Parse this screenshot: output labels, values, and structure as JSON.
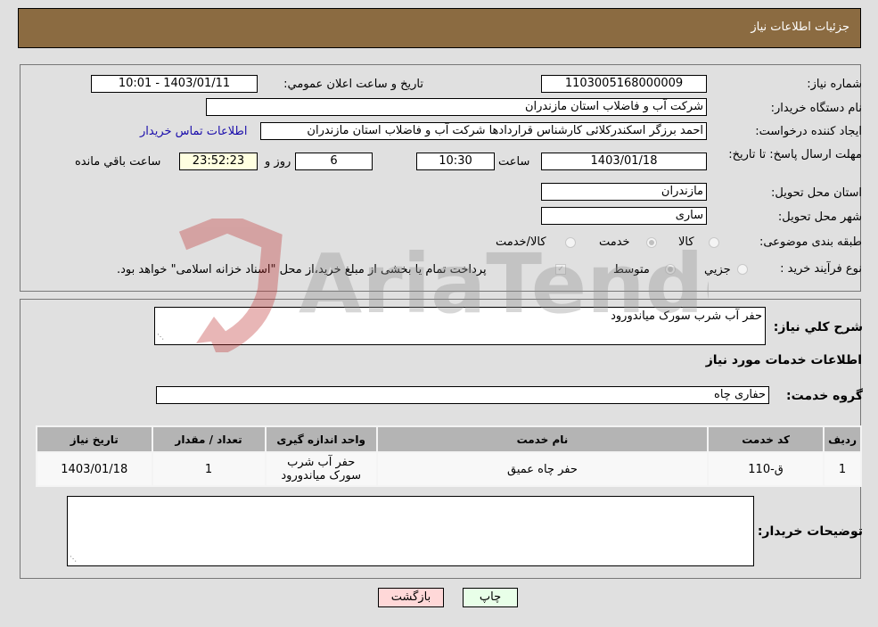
{
  "header": {
    "title": "جزئیات اطلاعات نیاز"
  },
  "need_info": {
    "need_number_label": "شماره نیاز:",
    "need_number": "1103005168000009",
    "announce_label": "تاریخ و ساعت اعلان عمومي:",
    "announce_value": "1403/01/11 - 10:01",
    "buyer_org_label": "نام دستگاه خریدار:",
    "buyer_org": "شرکت آب و فاضلاب استان مازندران",
    "creator_label": "ایجاد کننده درخواست:",
    "creator": "احمد برزگر اسکندرکلائی کارشناس قراردادها شرکت آب و فاضلاب استان مازندران",
    "buyer_contact_link": "اطلاعات تماس خریدار",
    "deadline_label": "مهلت ارسال پاسخ: تا تاریخ:",
    "deadline_date": "1403/01/18",
    "time_label": "ساعت",
    "deadline_time": "10:30",
    "days_remaining": "6",
    "days_label": "روز و",
    "time_remaining": "23:52:23",
    "time_remaining_label": "ساعت باقي مانده",
    "province_label": "استان محل تحویل:",
    "province": "مازندران",
    "city_label": "شهر محل تحویل:",
    "city": "ساری",
    "category_label": "طبقه بندی موضوعی:",
    "category_options": [
      {
        "label": "کالا",
        "checked": false
      },
      {
        "label": "خدمت",
        "checked": true
      },
      {
        "label": "کالا/خدمت",
        "checked": false
      }
    ],
    "process_label": "نوع فرآیند خرید :",
    "process_options": [
      {
        "label": "جزيي",
        "checked": false
      },
      {
        "label": "متوسط",
        "checked": true
      }
    ],
    "treasury_checkbox_checked": true,
    "treasury_note": "پرداخت تمام یا بخشی از مبلغ خرید،از محل \"اسناد خزانه اسلامی\" خواهد بود."
  },
  "details": {
    "description_label": "شرح كلي نياز:",
    "description": "حفر آب شرب سورک میاندورود",
    "services_heading": "اطلاعات خدمات مورد نیاز",
    "service_group_label": "گروه خدمت:",
    "service_group": "حفاری چاه",
    "table": {
      "columns": [
        "ردیف",
        "کد خدمت",
        "نام خدمت",
        "واحد اندازه گیری",
        "تعداد / مقدار",
        "تاریخ نیاز"
      ],
      "rows": [
        [
          "1",
          "ق-110",
          "حفر چاه عمیق",
          "حفر آب شرب سورک میاندورود",
          "1",
          "1403/01/18"
        ]
      ]
    },
    "buyer_notes_label": "توضیحات خریدار:",
    "buyer_notes": ""
  },
  "buttons": {
    "print": "چاپ",
    "back": "بازگشت"
  },
  "watermark": {
    "text": "AriaTender.neT"
  }
}
